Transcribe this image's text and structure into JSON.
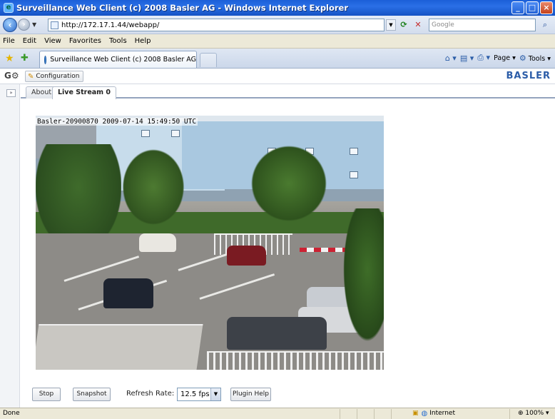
{
  "window": {
    "title": "Surveillance Web Client (c) 2008 Basler AG - Windows Internet Explorer",
    "buttons": {
      "minimize": "_",
      "maximize": "□",
      "close": "×"
    }
  },
  "address": {
    "url": "http://172.17.1.44/webapp/",
    "search_placeholder": "Google"
  },
  "menu": [
    "File",
    "Edit",
    "View",
    "Favorites",
    "Tools",
    "Help"
  ],
  "browser_tab": {
    "label": "Surveillance Web Client (c) 2008 Basler AG"
  },
  "command_bar": {
    "page": "Page",
    "tools": "Tools"
  },
  "webapp": {
    "config_label": "Configuration",
    "brand": "BASLER",
    "tabs": [
      "About",
      "Live Stream 0"
    ],
    "osd": "Basler-20900870 2009-07-14 15:49:50 UTC"
  },
  "controls": {
    "stop": "Stop",
    "snapshot": "Snapshot",
    "refresh_label": "Refresh Rate:",
    "refresh_value": "12.5 fps",
    "plugin_help": "Plugin Help"
  },
  "status": {
    "text": "Done",
    "zone": "Internet",
    "zoom": "100%"
  }
}
